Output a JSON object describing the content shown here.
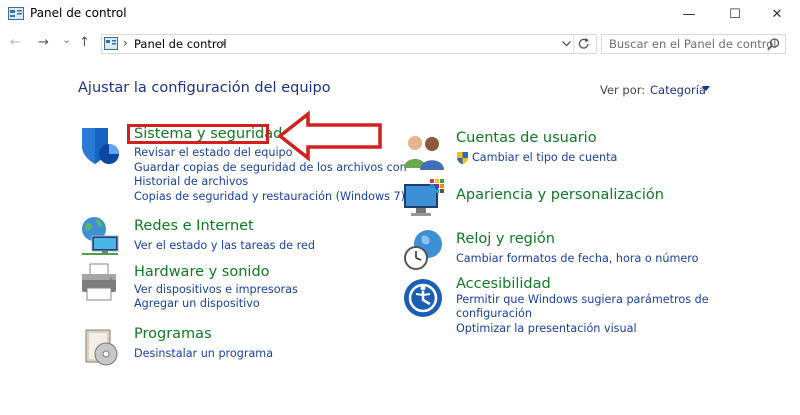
{
  "window": {
    "title": "Panel de control",
    "minimize": "—",
    "maximize": "☐",
    "close": "✕"
  },
  "nav": {
    "back": "←",
    "forward": "→",
    "recent": "⌄",
    "up": "↑",
    "breadcrumb": "Panel de control",
    "breadcrumb_sep": "›",
    "search_placeholder": "Buscar en el Panel de control"
  },
  "main": {
    "heading": "Ajustar la configuración del equipo",
    "view_by_label": "Ver por:",
    "view_by_value": "Categoría",
    "categories_left": [
      {
        "title": "Sistema y seguridad",
        "icon": "shield-icon",
        "links": [
          "Revisar el estado del equipo",
          "Guardar copias de seguridad de los archivos con",
          "Historial de archivos",
          "Copias de seguridad y restauración (Windows 7)"
        ]
      },
      {
        "title": "Redes e Internet",
        "icon": "network-globe-icon",
        "links": [
          "Ver el estado y las tareas de red"
        ]
      },
      {
        "title": "Hardware y sonido",
        "icon": "printer-icon",
        "links": [
          "Ver dispositivos e impresoras",
          "Agregar un dispositivo"
        ]
      },
      {
        "title": "Programas",
        "icon": "programs-disc-icon",
        "links": [
          "Desinstalar un programa"
        ]
      }
    ],
    "categories_right": [
      {
        "title": "Cuentas de usuario",
        "icon": "users-icon",
        "links": [
          "Cambiar el tipo de cuenta"
        ]
      },
      {
        "title": "Apariencia y personalización",
        "icon": "monitor-palette-icon",
        "links": []
      },
      {
        "title": "Reloj y región",
        "icon": "clock-globe-icon",
        "links": [
          "Cambiar formatos de fecha, hora o número"
        ]
      },
      {
        "title": "Accesibilidad",
        "icon": "accessibility-icon",
        "links": [
          "Permitir que Windows sugiera parámetros de",
          "configuración",
          "Optimizar la presentación visual"
        ]
      }
    ]
  },
  "colors": {
    "category_green": "#0f7a23",
    "link_blue": "#1a3fa3",
    "heading_blue": "#1e3287",
    "annotation_red": "#d21f1f"
  }
}
